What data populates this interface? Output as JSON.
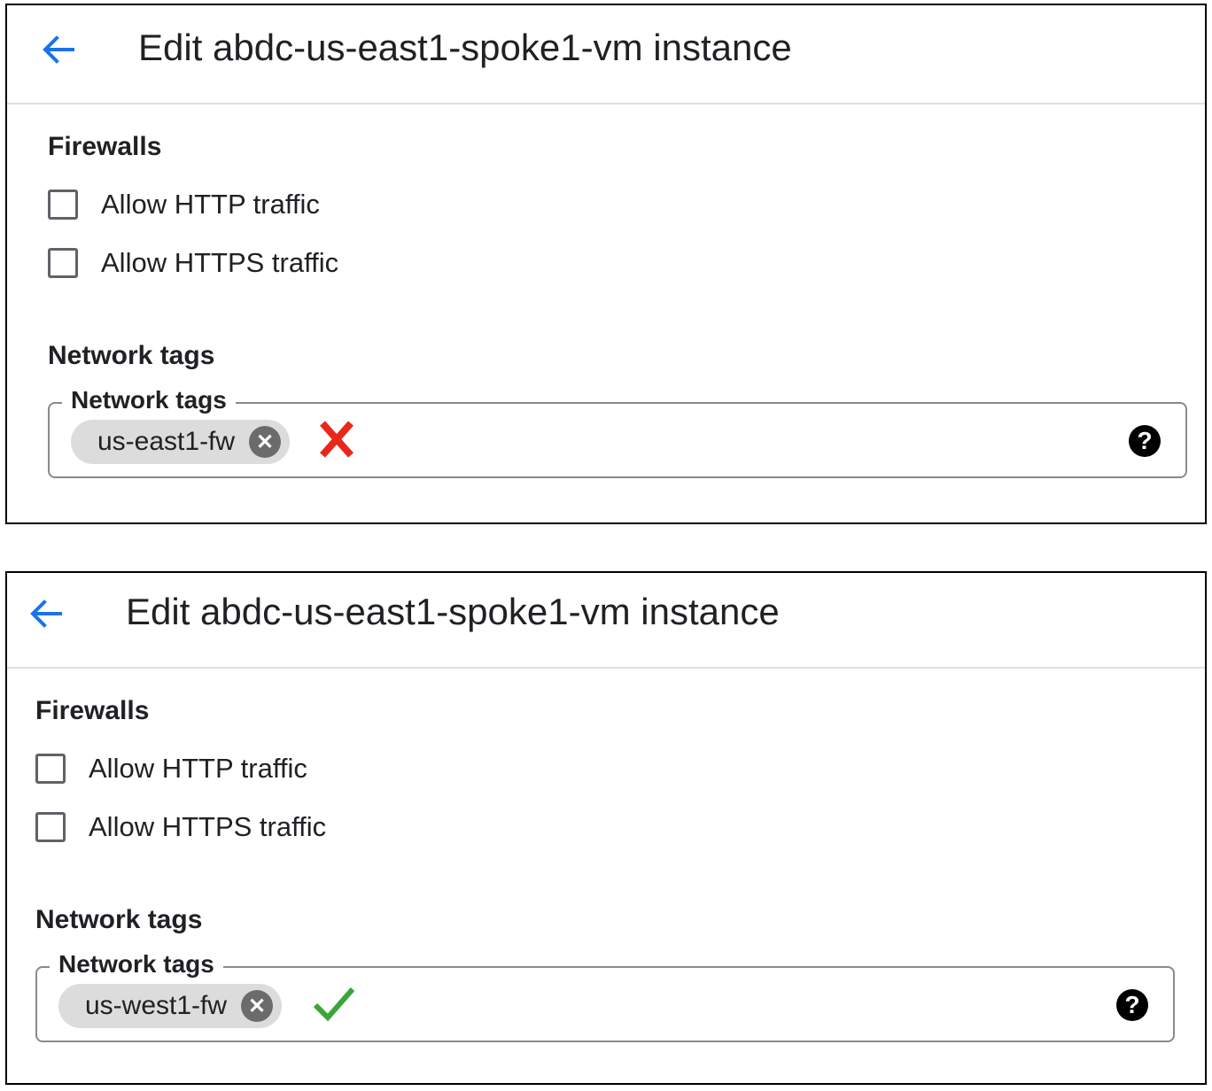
{
  "panels": [
    {
      "title": "Edit abdc-us-east1-spoke1-vm instance",
      "firewalls_heading": "Firewalls",
      "checkboxes": [
        {
          "label": "Allow HTTP traffic",
          "checked": false
        },
        {
          "label": "Allow HTTPS traffic",
          "checked": false
        }
      ],
      "network_tags_heading": "Network tags",
      "field_label": "Network tags",
      "tag": "us-east1-fw",
      "chip_remove_glyph": "✕",
      "help_glyph": "?",
      "indicator": {
        "icon": "red-x-mark-icon",
        "color": "#e8281b"
      }
    },
    {
      "title": "Edit abdc-us-east1-spoke1-vm instance",
      "firewalls_heading": "Firewalls",
      "checkboxes": [
        {
          "label": "Allow HTTP traffic",
          "checked": false
        },
        {
          "label": "Allow HTTPS traffic",
          "checked": false
        }
      ],
      "network_tags_heading": "Network tags",
      "field_label": "Network tags",
      "tag": "us-west1-fw",
      "chip_remove_glyph": "✕",
      "help_glyph": "?",
      "indicator": {
        "icon": "green-check-mark-icon",
        "color": "#3aa63a"
      }
    }
  ],
  "colors": {
    "back_arrow": "#1a73e8",
    "chip_bg": "#dcdcdc"
  }
}
